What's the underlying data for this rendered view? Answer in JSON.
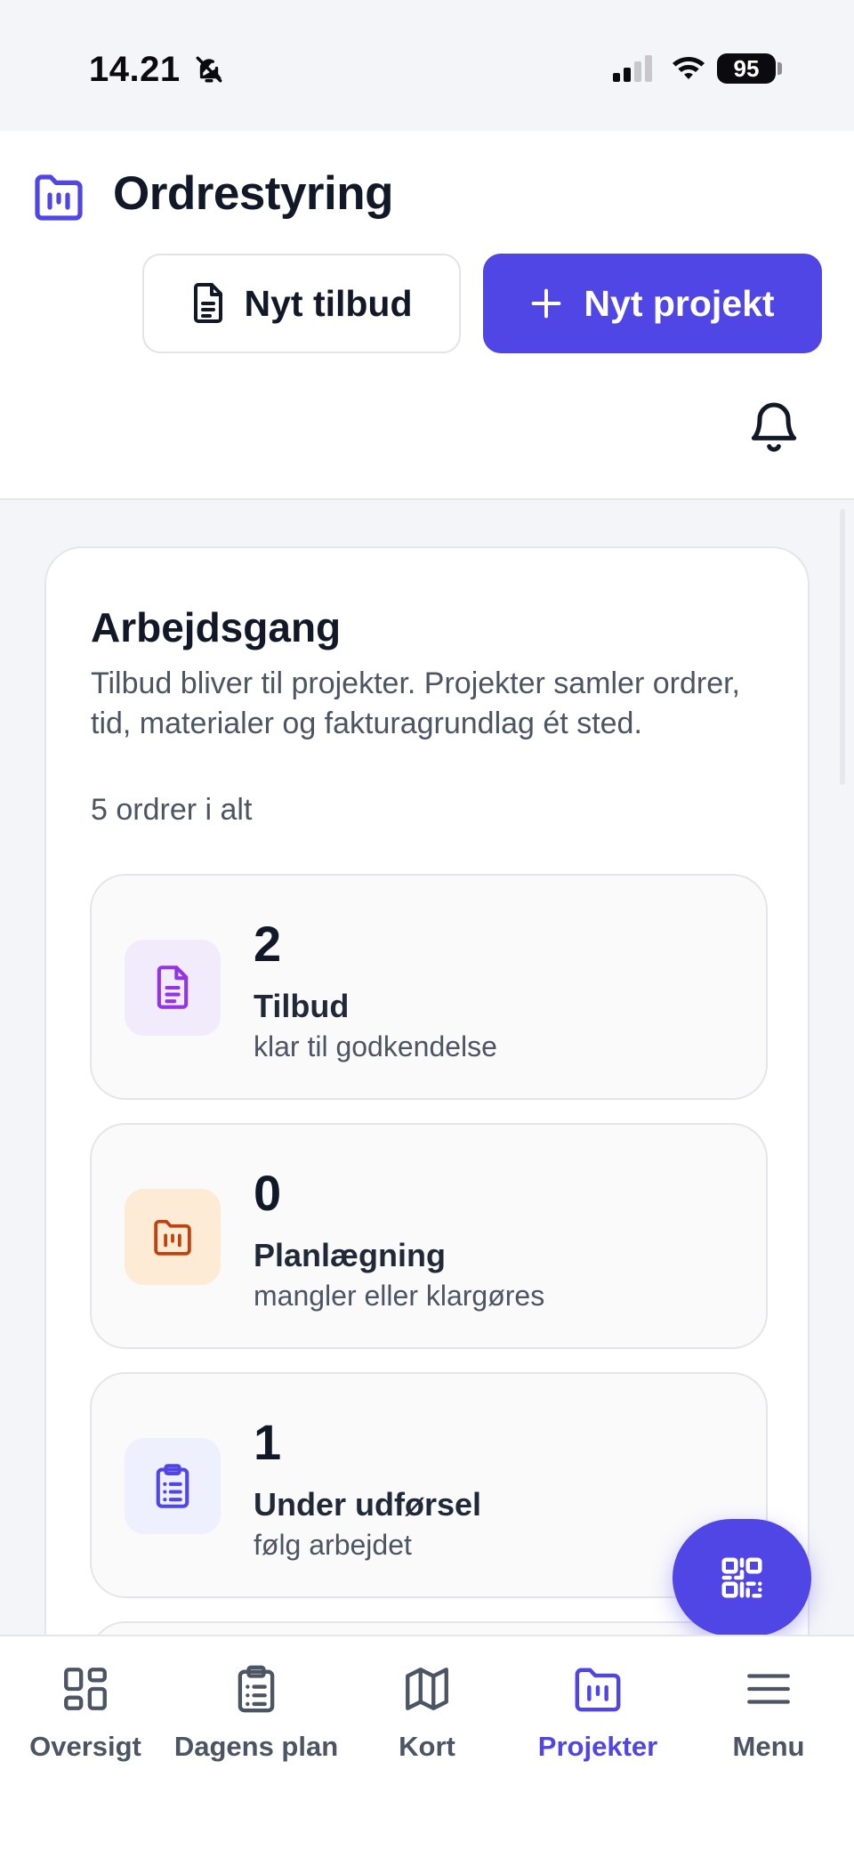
{
  "status_bar": {
    "time": "14.21",
    "battery": "95"
  },
  "header": {
    "title": "Ordrestyring",
    "new_quote_label": "Nyt tilbud",
    "new_project_label": "Nyt projekt"
  },
  "workflow": {
    "title": "Arbejdsgang",
    "description": "Tilbud bliver til projekter. Projekter samler ordrer, tid, materialer og fakturagrundlag ét sted.",
    "count_text": "5 ordrer i alt",
    "stages": [
      {
        "count": "2",
        "label": "Tilbud",
        "sub": "klar til godkendelse",
        "icon": "document-icon",
        "icon_color": "#9333ea",
        "icon_bg": "#f1ebfb"
      },
      {
        "count": "0",
        "label": "Planlægning",
        "sub": "mangler eller klargøres",
        "icon": "folder-kanban-icon",
        "icon_color": "#c2410c",
        "icon_bg": "#fdebd5"
      },
      {
        "count": "1",
        "label": "Under udførsel",
        "sub": "følg arbejdet",
        "icon": "clipboard-list-icon",
        "icon_color": "#4f46e5",
        "icon_bg": "#eef0fd"
      }
    ]
  },
  "nav": {
    "items": [
      {
        "label": "Oversigt",
        "icon": "dashboard-icon",
        "active": false
      },
      {
        "label": "Dagens plan",
        "icon": "clipboard-icon",
        "active": false
      },
      {
        "label": "Kort",
        "icon": "map-icon",
        "active": false
      },
      {
        "label": "Projekter",
        "icon": "folder-icon",
        "active": true
      },
      {
        "label": "Menu",
        "icon": "menu-icon",
        "active": false
      }
    ]
  },
  "colors": {
    "accent": "#4f46e5",
    "text": "#111827",
    "muted": "#4b5563"
  }
}
